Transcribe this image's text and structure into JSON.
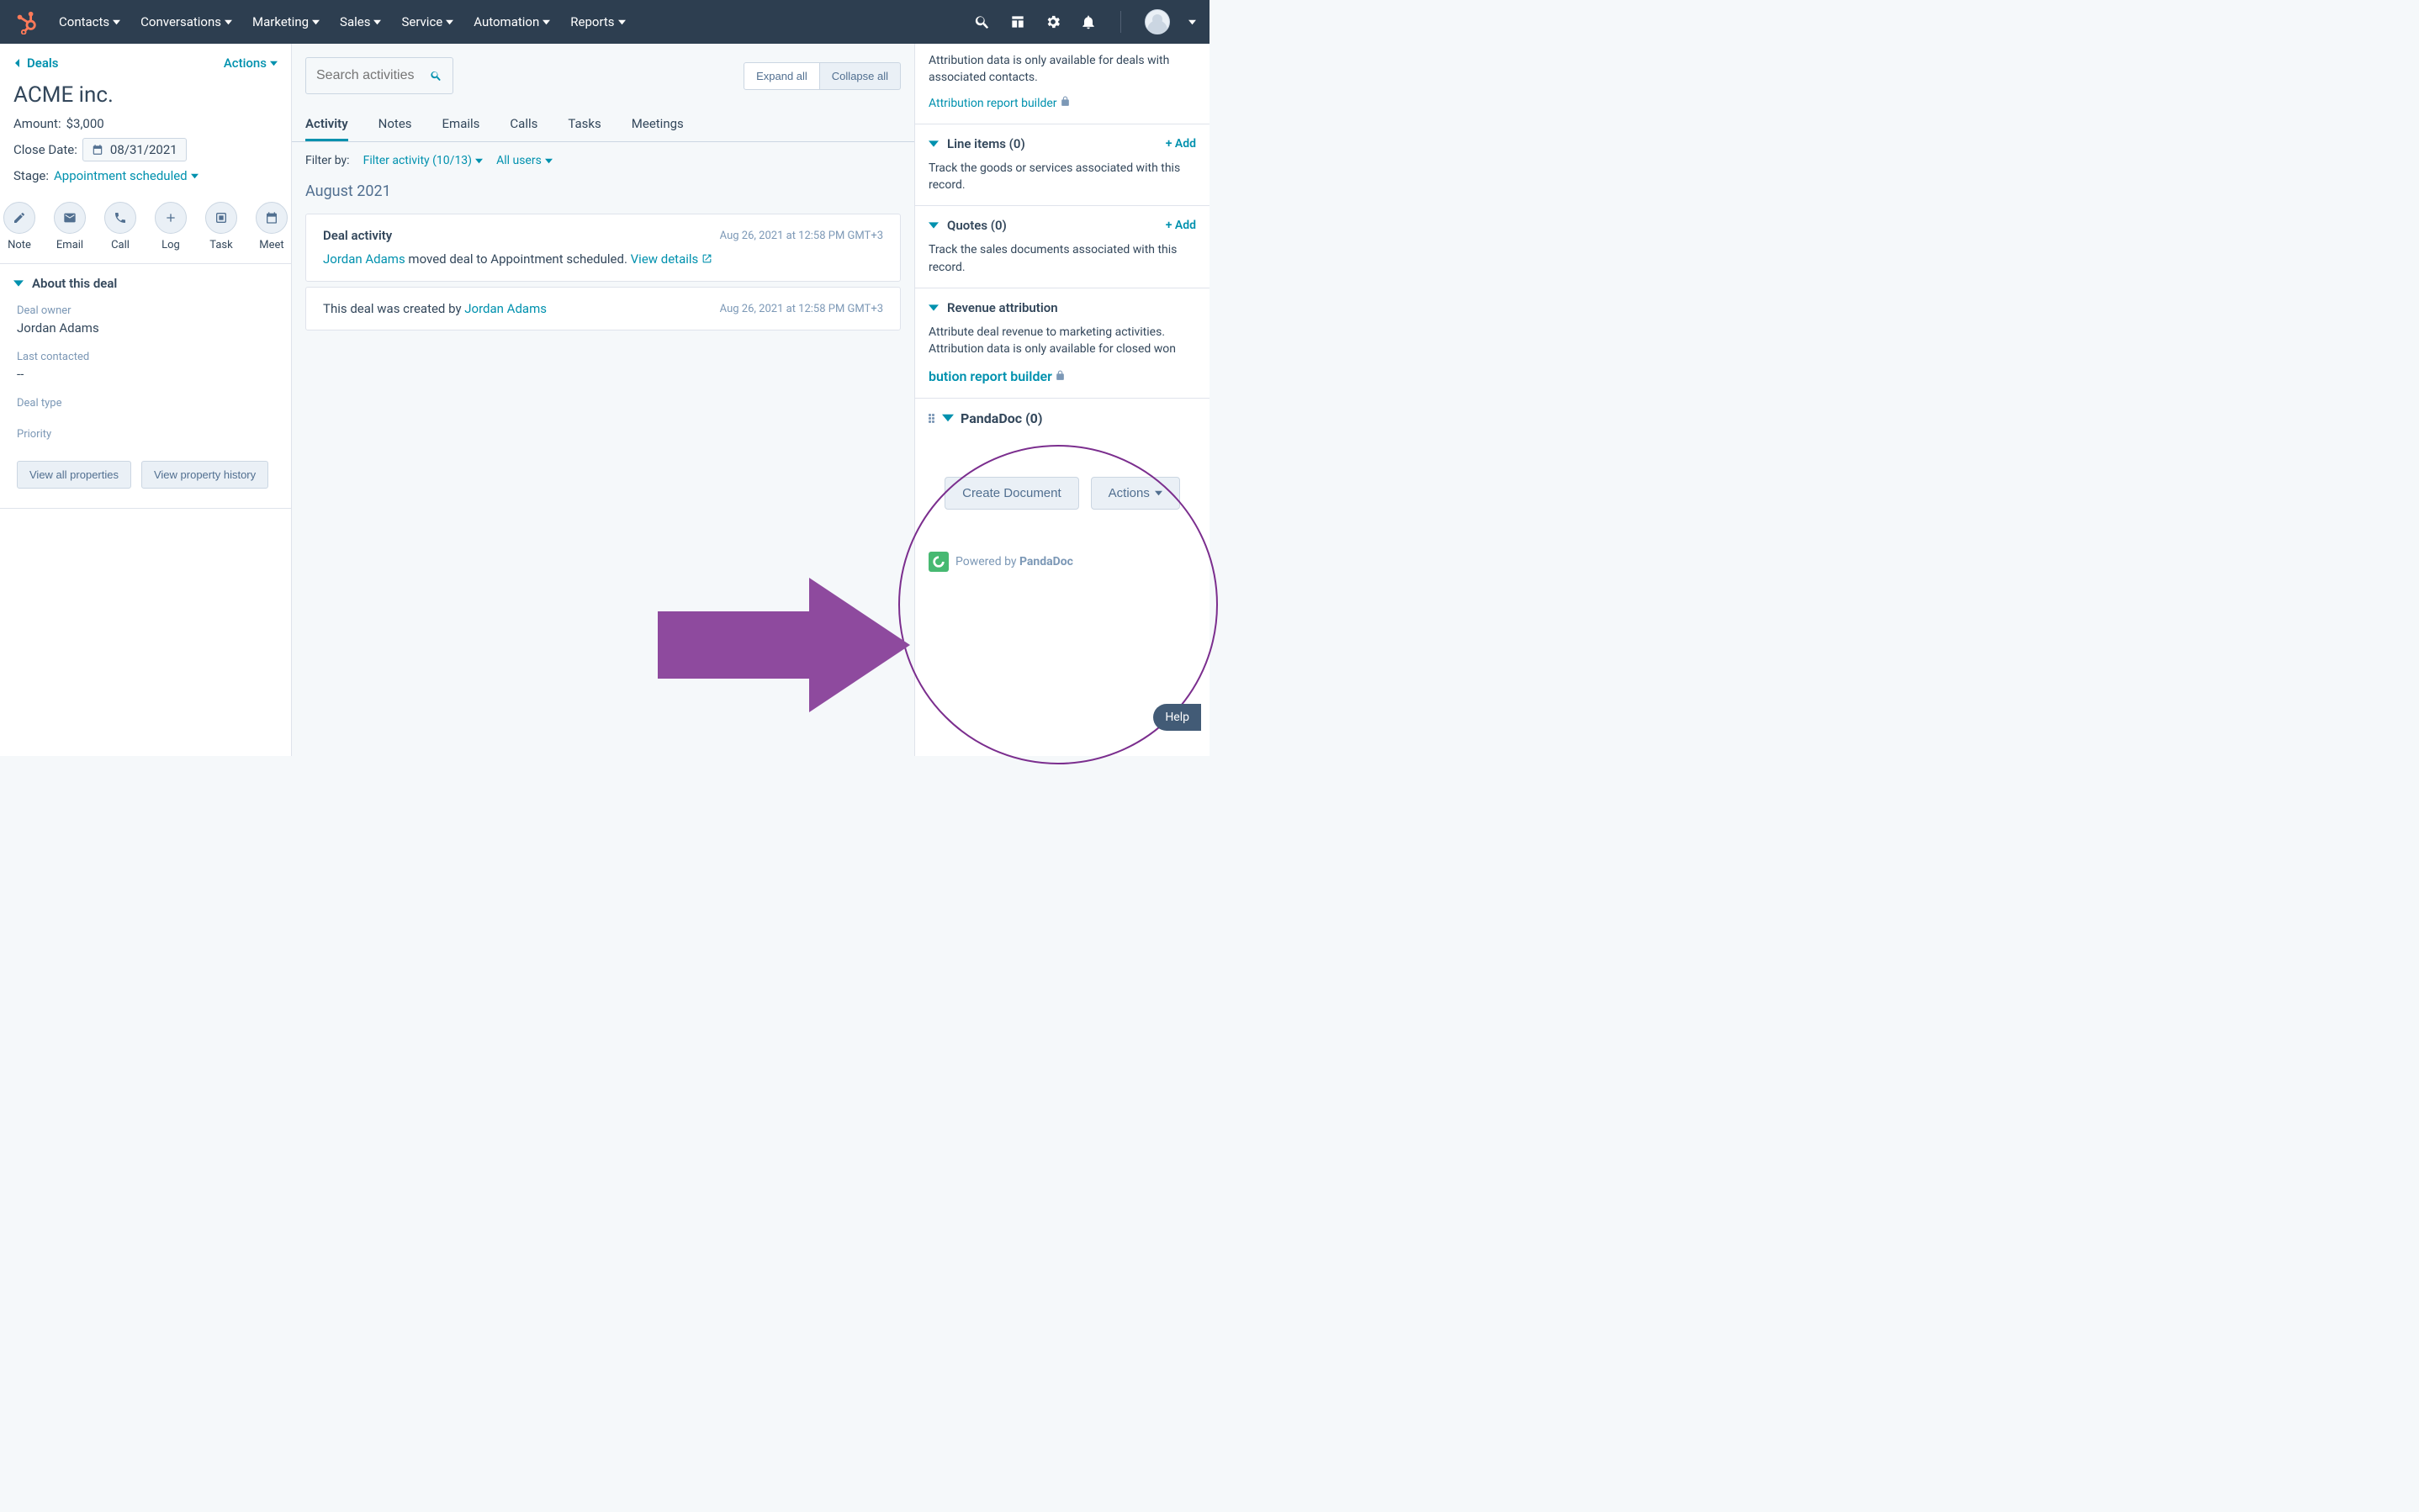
{
  "topnav": {
    "items": [
      "Contacts",
      "Conversations",
      "Marketing",
      "Sales",
      "Service",
      "Automation",
      "Reports"
    ]
  },
  "left": {
    "back_label": "Deals",
    "actions_label": "Actions",
    "deal_title": "ACME inc.",
    "amount_label": "Amount:",
    "amount_value": "$3,000",
    "close_label": "Close Date:",
    "close_value": "08/31/2021",
    "stage_label": "Stage:",
    "stage_value": "Appointment scheduled",
    "action_buttons": [
      {
        "label": "Note",
        "icon": "pencil"
      },
      {
        "label": "Email",
        "icon": "mail"
      },
      {
        "label": "Call",
        "icon": "phone"
      },
      {
        "label": "Log",
        "icon": "plus"
      },
      {
        "label": "Task",
        "icon": "task"
      },
      {
        "label": "Meet",
        "icon": "calendar"
      }
    ],
    "about_title": "About this deal",
    "props": [
      {
        "label": "Deal owner",
        "value": "Jordan Adams"
      },
      {
        "label": "Last contacted",
        "value": "--"
      },
      {
        "label": "Deal type",
        "value": ""
      },
      {
        "label": "Priority",
        "value": ""
      }
    ],
    "view_all": "View all properties",
    "view_history": "View property history"
  },
  "mid": {
    "search_placeholder": "Search activities",
    "expand": "Expand all",
    "collapse": "Collapse all",
    "tabs": [
      "Activity",
      "Notes",
      "Emails",
      "Calls",
      "Tasks",
      "Meetings"
    ],
    "filter_by": "Filter by:",
    "filter_activity": "Filter activity (10/13)",
    "all_users": "All users",
    "month": "August 2021",
    "card1": {
      "title": "Deal activity",
      "user": "Jordan Adams",
      "body_middle": " moved deal to Appointment scheduled. ",
      "view": "View details",
      "ts": "Aug 26, 2021 at 12:58 PM GMT+3"
    },
    "card2": {
      "body_pre": "This deal was created by ",
      "user": "Jordan Adams",
      "ts": "Aug 26, 2021 at 12:58 PM GMT+3"
    }
  },
  "right": {
    "attrib_top_desc": "Attribution data is only available for deals with associated contacts.",
    "attrib_top_link": "Attribution report builder",
    "line_items_title": "Line items (0)",
    "line_items_desc": "Track the goods or services associated with this record.",
    "quotes_title": "Quotes (0)",
    "quotes_desc": "Track the sales documents associated with this record.",
    "revenue_title": "Revenue attribution",
    "revenue_desc": "Attribute deal revenue to marketing activities. Attribution data is only available for closed won",
    "revenue_link": "bution report builder",
    "add_label": "+ Add",
    "pandadoc": {
      "title": "PandaDoc (0)",
      "create": "Create Document",
      "actions": "Actions",
      "powered_pre": "Powered by ",
      "powered_brand": "PandaDoc"
    }
  },
  "help": "Help"
}
